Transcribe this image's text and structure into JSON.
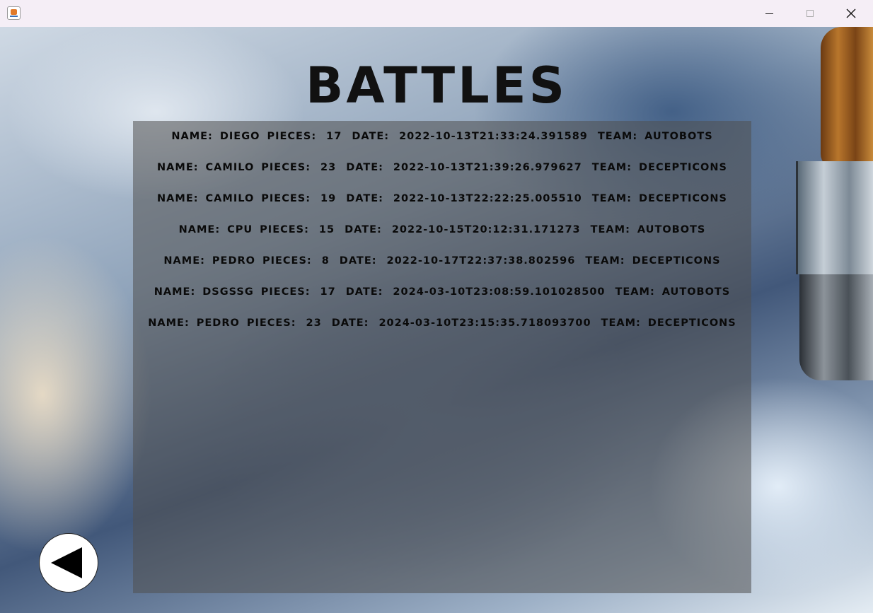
{
  "window": {
    "icon": "java-cup-icon",
    "controls": [
      "minimize-icon",
      "maximize-icon",
      "close-icon"
    ]
  },
  "title": "BATTLES",
  "labels": {
    "name": "NAME:",
    "pieces": "PIECES:",
    "date": "DATE:",
    "team": "TEAM:"
  },
  "battles": [
    {
      "name": "DIEGO",
      "pieces": "17",
      "date": "2022-10-13T21:33:24.391589",
      "team": "AUTOBOTS"
    },
    {
      "name": "CAMILO",
      "pieces": "23",
      "date": "2022-10-13T21:39:26.979627",
      "team": "DECEPTICONS"
    },
    {
      "name": "CAMILO",
      "pieces": "19",
      "date": "2022-10-13T22:22:25.005510",
      "team": "DECEPTICONS"
    },
    {
      "name": "CPU",
      "pieces": "15",
      "date": "2022-10-15T20:12:31.171273",
      "team": "AUTOBOTS"
    },
    {
      "name": "PEDRO",
      "pieces": "8",
      "date": "2022-10-17T22:37:38.802596",
      "team": "DECEPTICONS"
    },
    {
      "name": "DSGSSG",
      "pieces": "17",
      "date": "2024-03-10T23:08:59.101028500",
      "team": "AUTOBOTS"
    },
    {
      "name": "PEDRO",
      "pieces": "23",
      "date": "2024-03-10T23:15:35.718093700",
      "team": "DECEPTICONS"
    }
  ],
  "back_button": {
    "icon": "back-arrow-icon"
  }
}
